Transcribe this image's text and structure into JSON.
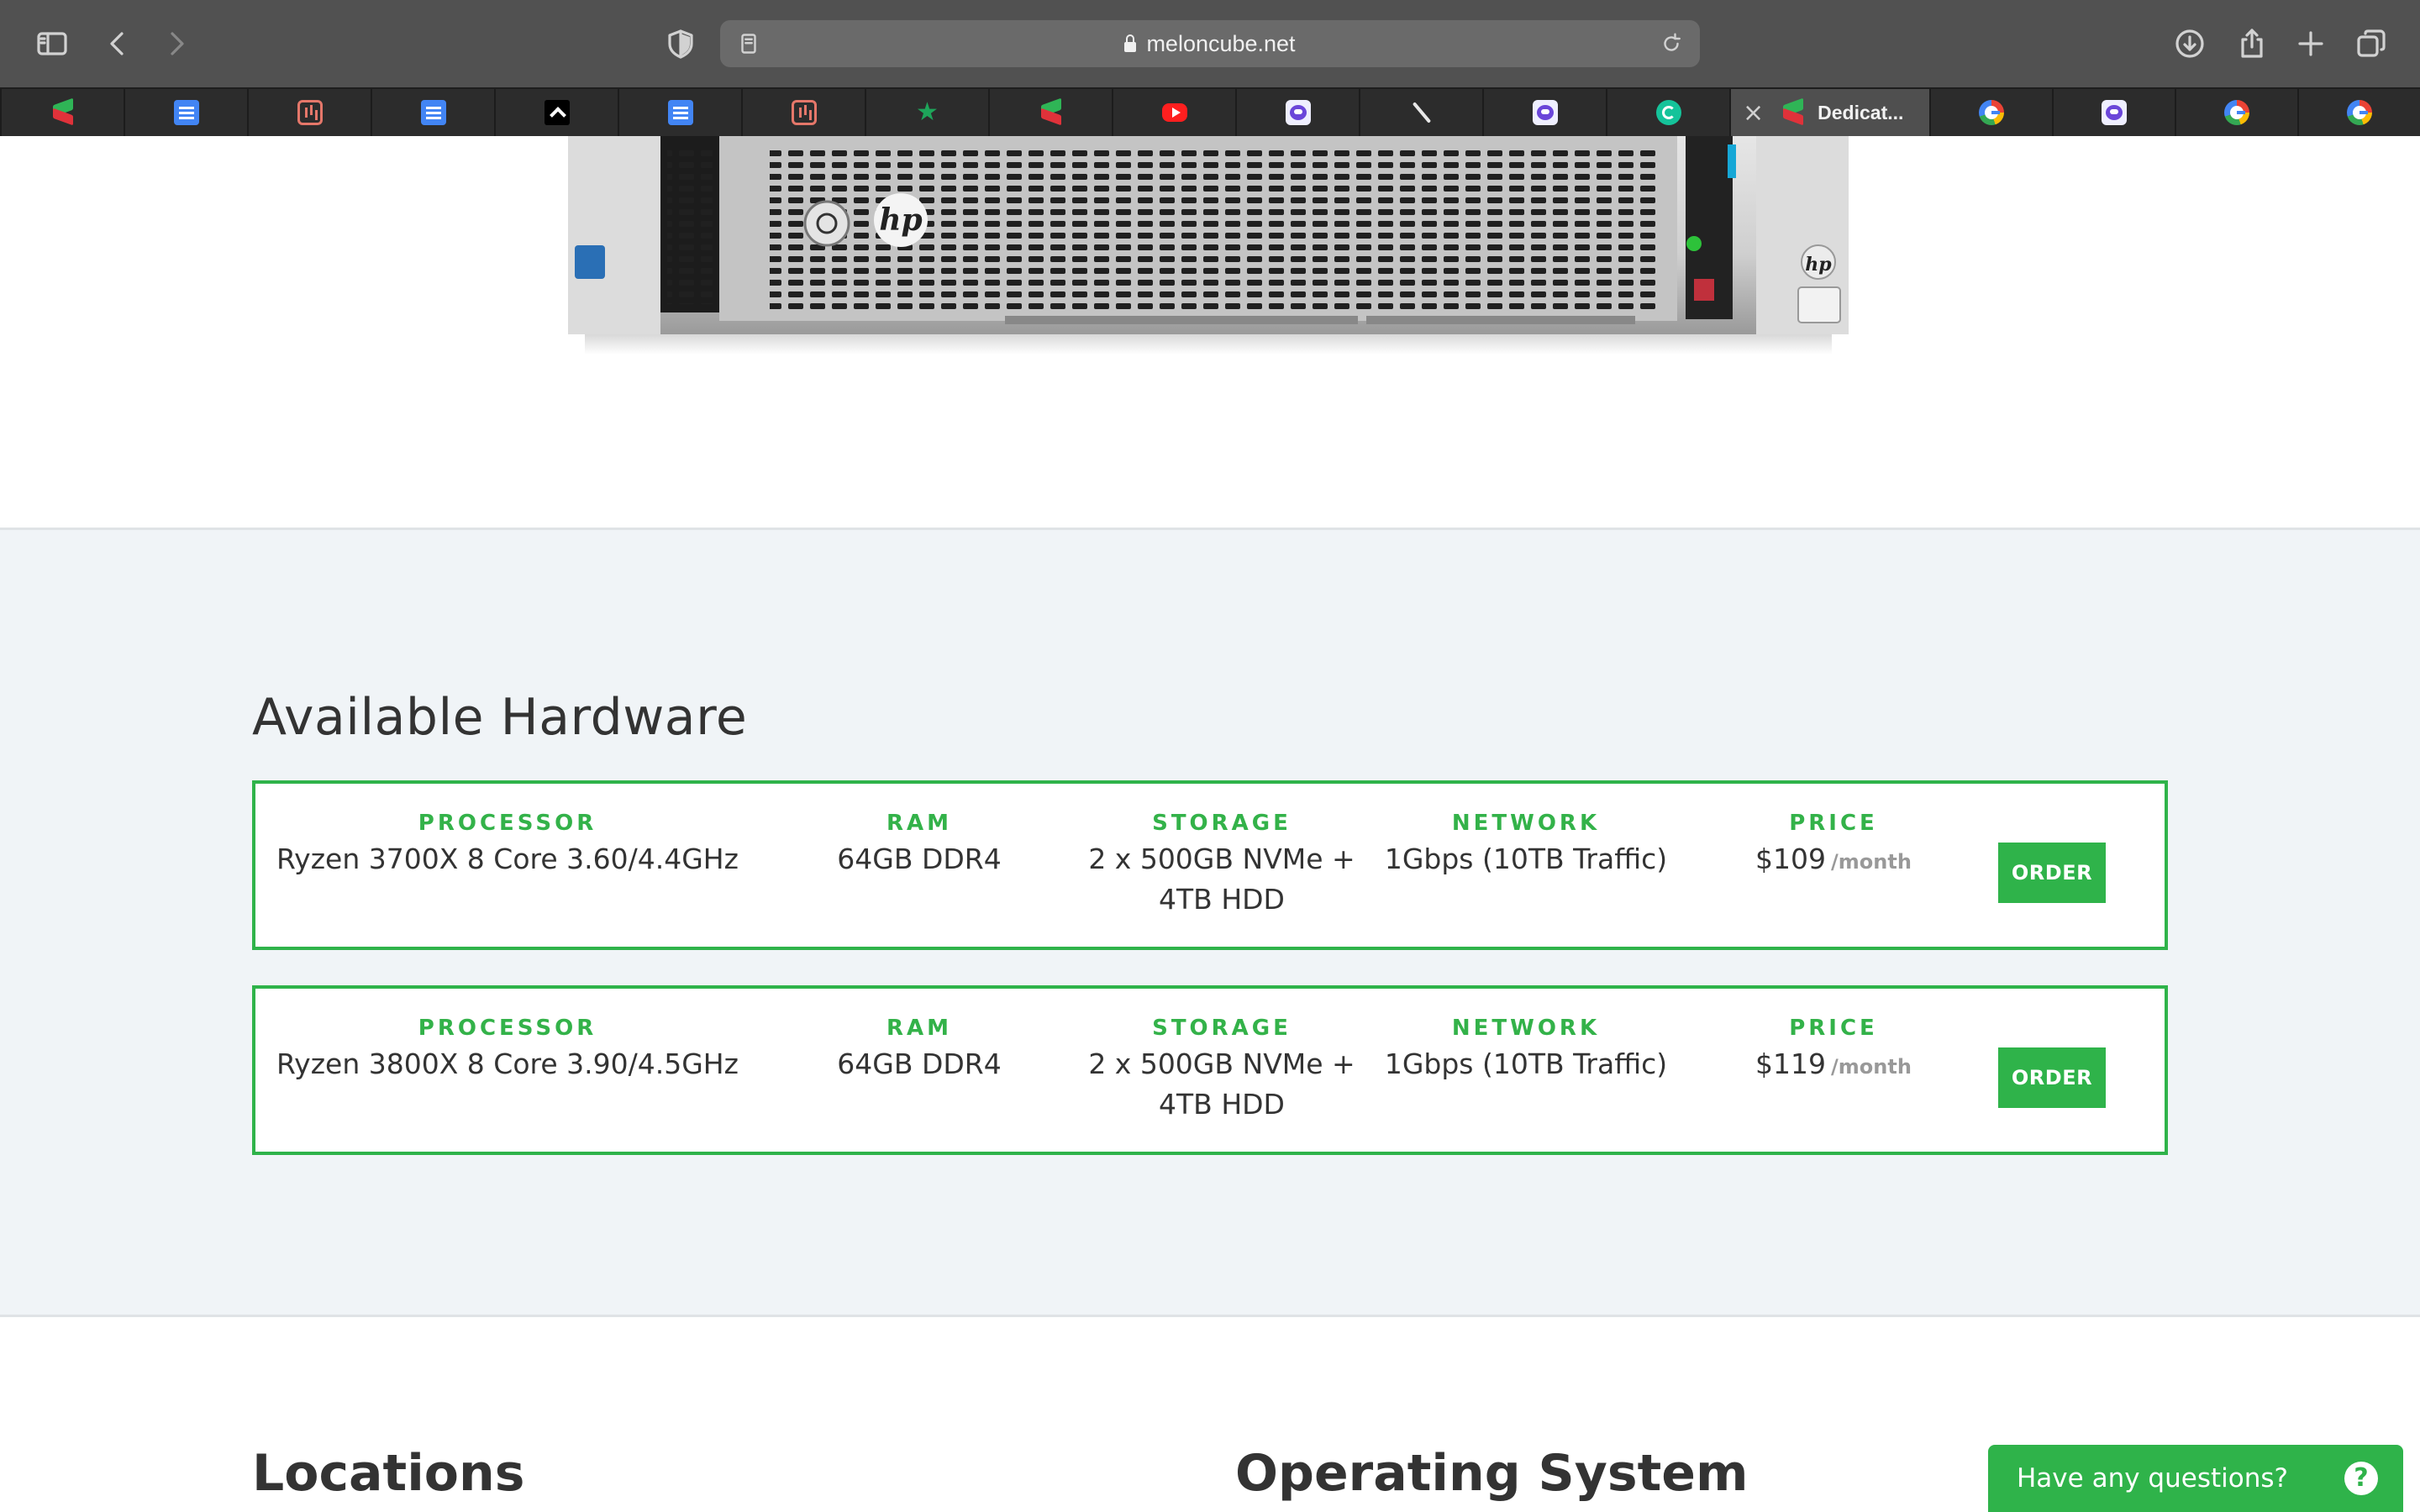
{
  "browser": {
    "url": "meloncube.net",
    "active_tab_title": "Dedicat...",
    "tabs": [
      {
        "icon": "meloncube-favicon-icon"
      },
      {
        "icon": "google-docs-icon"
      },
      {
        "icon": "analytics-icon"
      },
      {
        "icon": "google-docs-icon"
      },
      {
        "icon": "chevron-up-favicon-icon"
      },
      {
        "icon": "google-docs-icon"
      },
      {
        "icon": "analytics-icon"
      },
      {
        "icon": "star-icon"
      },
      {
        "icon": "meloncube-favicon-icon"
      },
      {
        "icon": "youtube-icon"
      },
      {
        "icon": "robot-icon"
      },
      {
        "icon": "quill-icon"
      },
      {
        "icon": "robot-icon"
      },
      {
        "icon": "grammarly-icon"
      },
      {
        "icon": "meloncube-favicon-icon",
        "active": true
      },
      {
        "icon": "google-icon"
      },
      {
        "icon": "robot-icon"
      },
      {
        "icon": "google-icon"
      },
      {
        "icon": "google-icon"
      }
    ]
  },
  "hardware": {
    "title": "Available Hardware",
    "labels": {
      "processor": "PROCESSOR",
      "ram": "RAM",
      "storage": "STORAGE",
      "network": "NETWORK",
      "price": "PRICE"
    },
    "rows": [
      {
        "processor": "Ryzen 3700X 8 Core 3.60/4.4GHz",
        "ram": "64GB DDR4",
        "storage_line1": "2 x 500GB NVMe +",
        "storage_line2": "4TB HDD",
        "network": "1Gbps (10TB Traffic)",
        "price": "$109",
        "price_unit": "/month",
        "order_label": "ORDER"
      },
      {
        "processor": "Ryzen 3800X 8 Core 3.90/4.5GHz",
        "ram": "64GB DDR4",
        "storage_line1": "2 x 500GB NVMe +",
        "storage_line2": "4TB HDD",
        "network": "1Gbps (10TB Traffic)",
        "price": "$119",
        "price_unit": "/month",
        "order_label": "ORDER"
      }
    ]
  },
  "sections": {
    "locations": "Locations",
    "operating_system": "Operating System"
  },
  "chat": {
    "label": "Have any questions?",
    "icon_glyph": "?"
  },
  "colors": {
    "accent": "#2fb34a",
    "section_bg": "#f0f4f7"
  }
}
